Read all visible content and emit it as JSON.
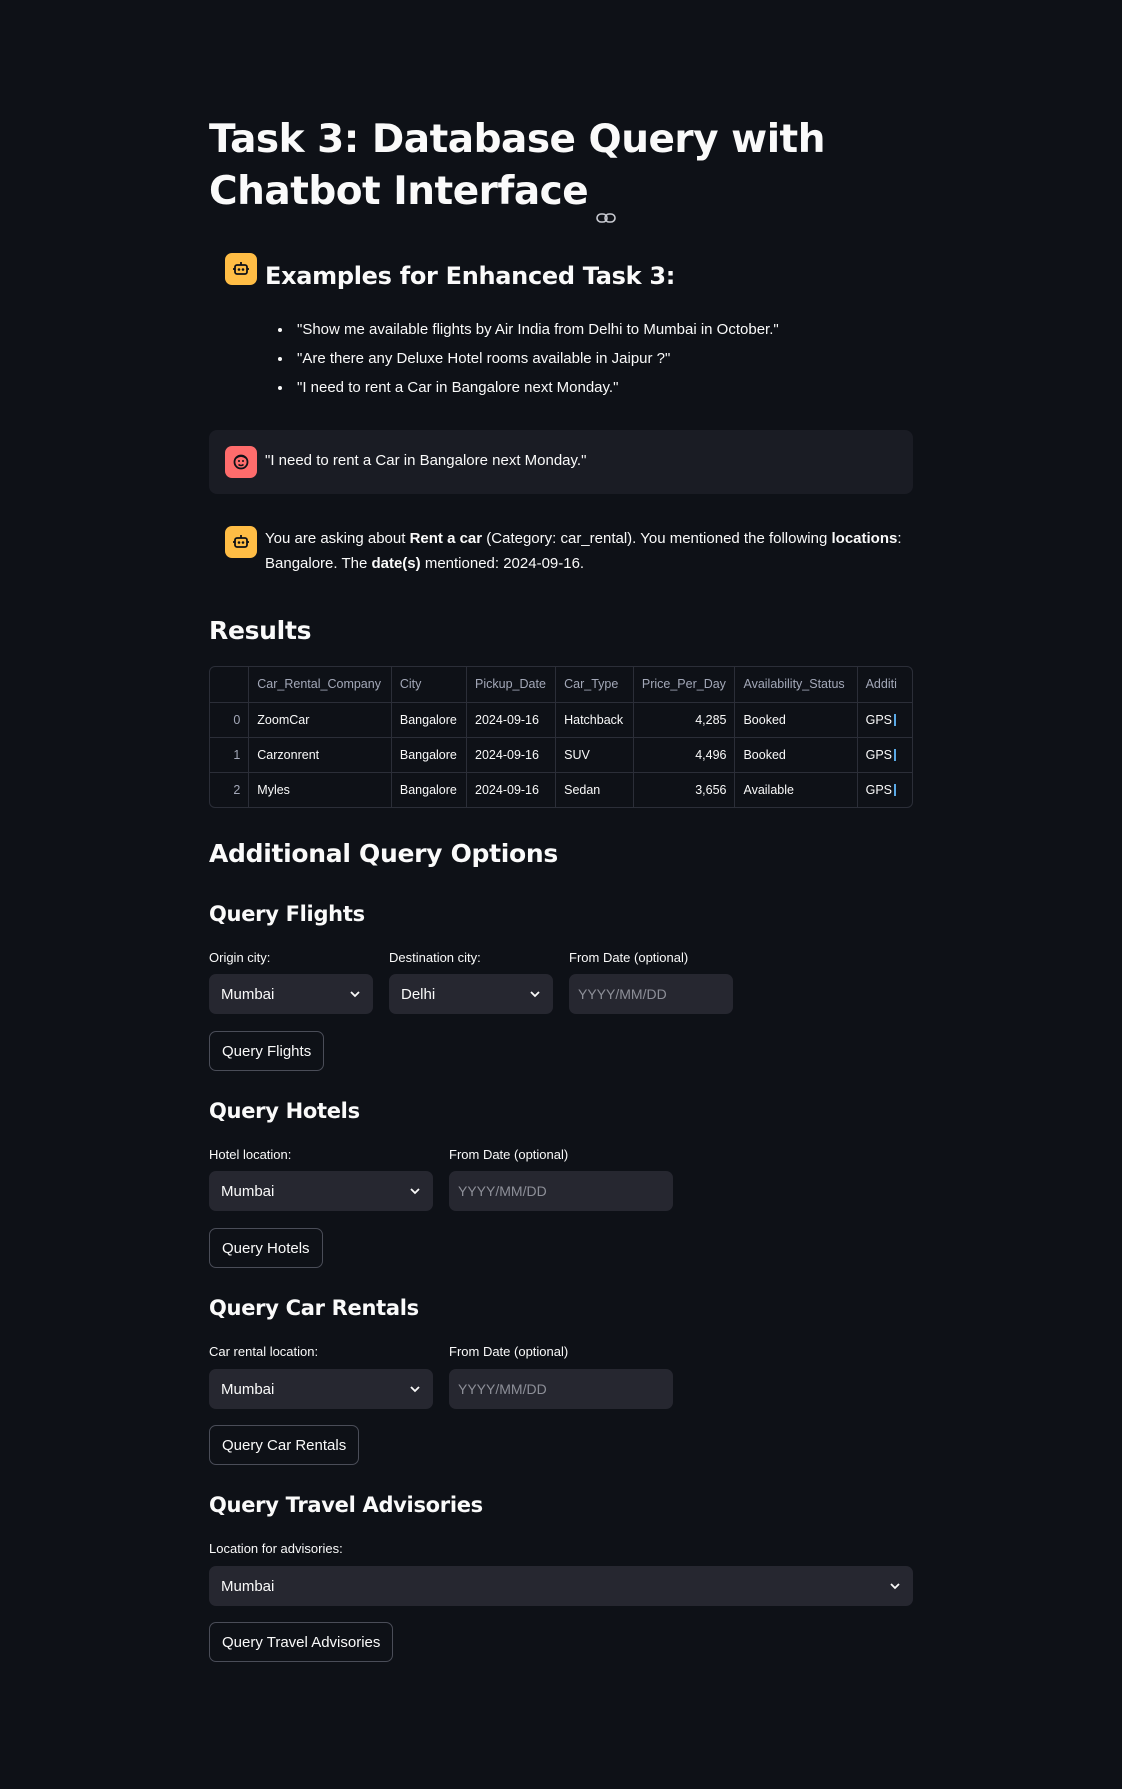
{
  "page": {
    "title": "Task 3: Database Query with Chatbot Interface"
  },
  "examples": {
    "title": "Examples for Enhanced Task 3:",
    "items": [
      "\"Show me available flights by Air India from Delhi to Mumbai in October.\"",
      "\"Are there any Deluxe Hotel rooms available in Jaipur ?\"",
      "\"I need to rent a Car in Bangalore next Monday.\""
    ]
  },
  "user_message": "\"I need to rent a Car in Bangalore next Monday.\"",
  "bot_response": {
    "part1": "You are asking about ",
    "bold1": "Rent a car",
    "part2": " (Category: car_rental). You mentioned the following ",
    "bold2": "locations",
    "part3": ": Bangalore. The ",
    "bold3": "date(s)",
    "part4": " mentioned: 2024-09-16."
  },
  "results": {
    "title": "Results",
    "columns": [
      "",
      "Car_Rental_Company",
      "City",
      "Pickup_Date",
      "Car_Type",
      "Price_Per_Day",
      "Availability_Status",
      "Additi"
    ],
    "rows": [
      [
        "0",
        "ZoomCar",
        "Bangalore",
        "2024-09-16",
        "Hatchback",
        "4,285",
        "Booked",
        "GPS"
      ],
      [
        "1",
        "Carzonrent",
        "Bangalore",
        "2024-09-16",
        "SUV",
        "4,496",
        "Booked",
        "GPS"
      ],
      [
        "2",
        "Myles",
        "Bangalore",
        "2024-09-16",
        "Sedan",
        "3,656",
        "Available",
        "GPS"
      ]
    ]
  },
  "additional": {
    "title": "Additional Query Options"
  },
  "flights": {
    "title": "Query Flights",
    "origin_label": "Origin city:",
    "origin_value": "Mumbai",
    "dest_label": "Destination city:",
    "dest_value": "Delhi",
    "date_label": "From Date (optional)",
    "date_placeholder": "YYYY/MM/DD",
    "button": "Query Flights"
  },
  "hotels": {
    "title": "Query Hotels",
    "location_label": "Hotel location:",
    "location_value": "Mumbai",
    "date_label": "From Date (optional)",
    "date_placeholder": "YYYY/MM/DD",
    "button": "Query Hotels"
  },
  "cars": {
    "title": "Query Car Rentals",
    "location_label": "Car rental location:",
    "location_value": "Mumbai",
    "date_label": "From Date (optional)",
    "date_placeholder": "YYYY/MM/DD",
    "button": "Query Car Rentals"
  },
  "advisories": {
    "title": "Query Travel Advisories",
    "location_label": "Location for advisories:",
    "location_value": "Mumbai",
    "button": "Query Travel Advisories"
  },
  "colors": {
    "background": "#0e1117",
    "surface": "#262730",
    "bot_avatar": "#ffbd45",
    "user_avatar": "#ff6c6c"
  }
}
